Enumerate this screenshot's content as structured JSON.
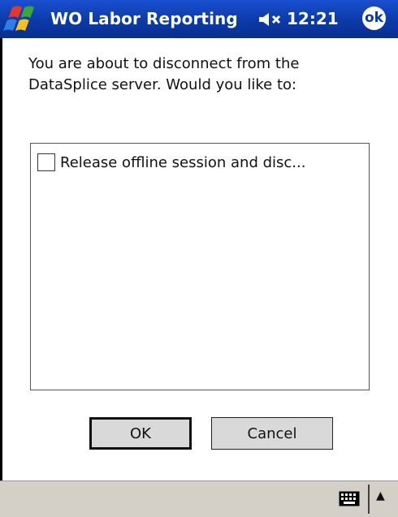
{
  "titlebar": {
    "title": "WO Labor Reporting",
    "time": "12:21",
    "ok_label": "ok",
    "start_icon": "windows-flag-icon",
    "speaker_icon": "speaker-muted-icon"
  },
  "dialog": {
    "message": "You are about to disconnect from the DataSplice server. Would you like to:",
    "options": [
      {
        "label": "Release offline session and disc...",
        "checked": false
      }
    ],
    "ok_button": "OK",
    "cancel_button": "Cancel"
  },
  "bottom_bar": {
    "keyboard_icon": "keyboard-icon",
    "arrow_icon": "up-arrow-icon"
  },
  "colors": {
    "titlebar": "#0b3aa8",
    "bottom_bar": "#d4d0c8",
    "button": "#d9d9d9"
  }
}
